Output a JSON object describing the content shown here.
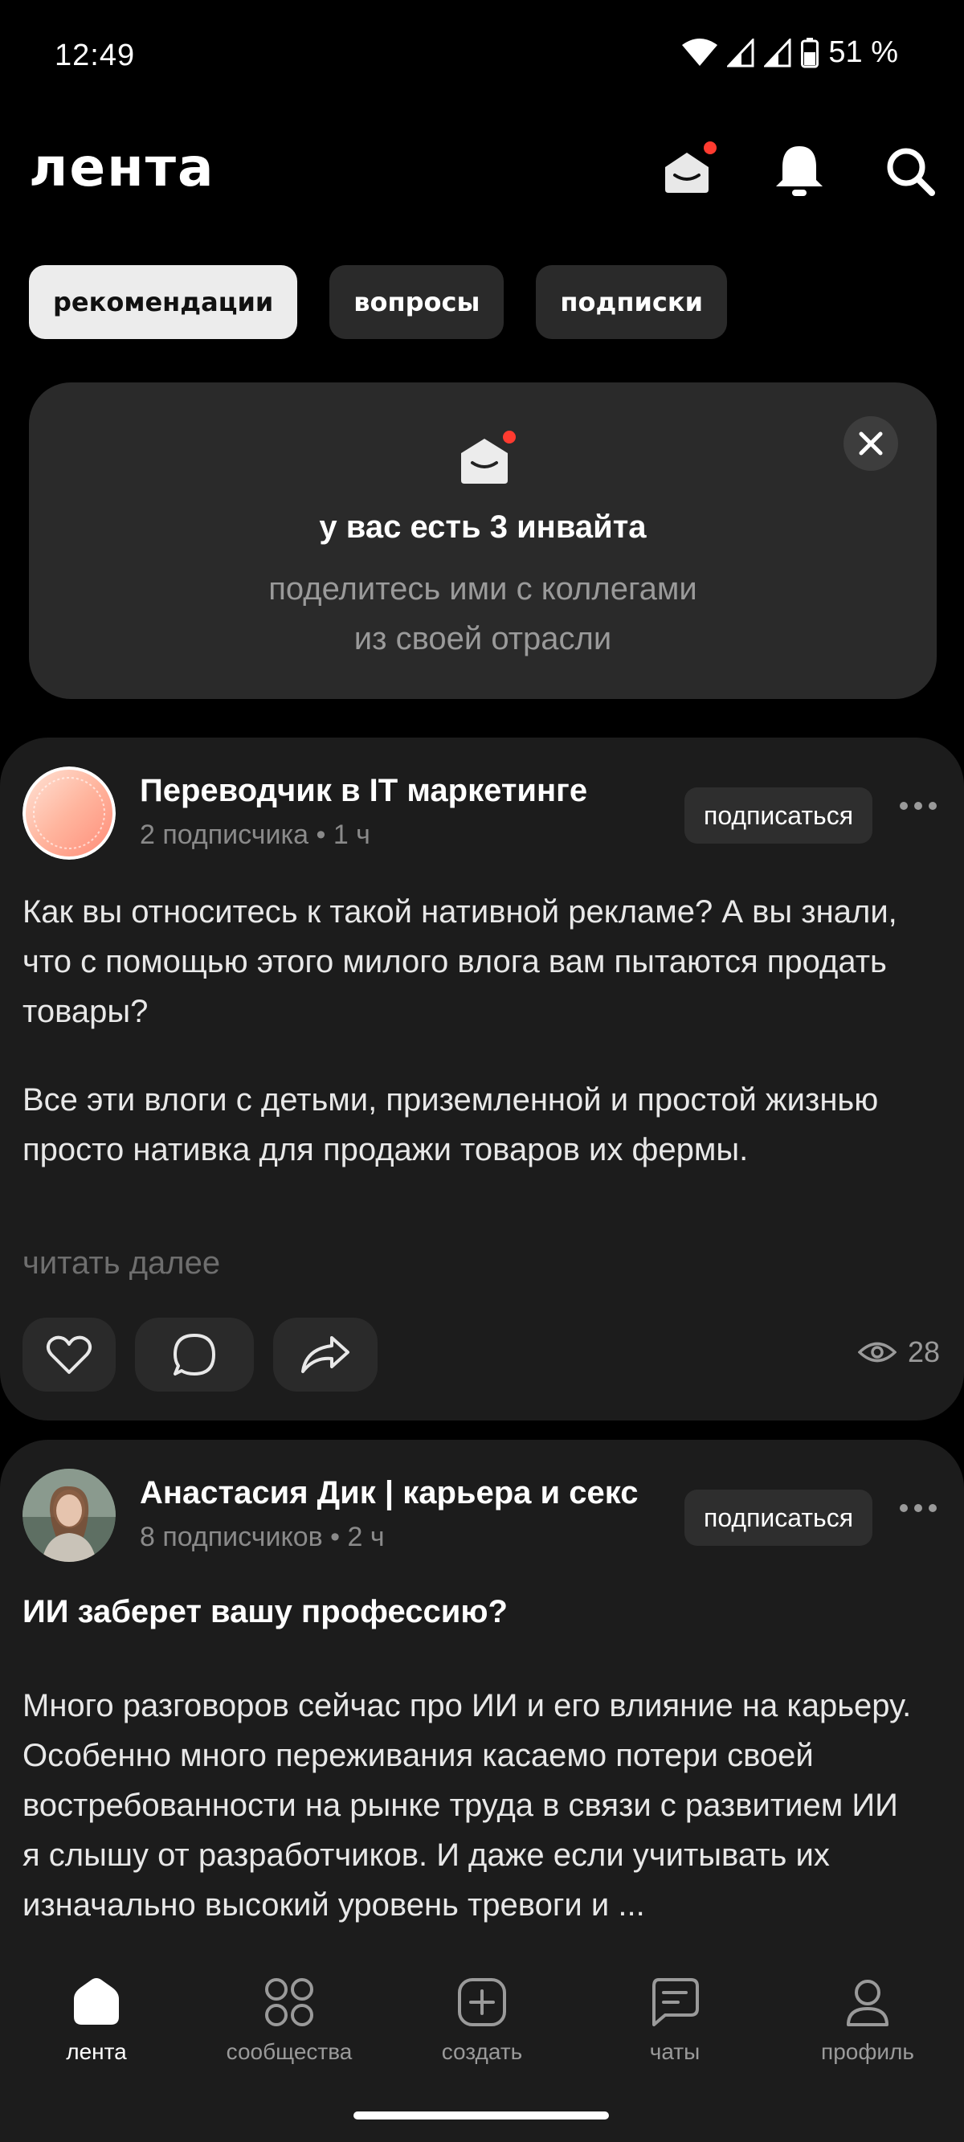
{
  "status": {
    "time": "12:49",
    "battery": "51 %"
  },
  "header": {
    "logo": "лента",
    "icons": [
      "mail-icon",
      "bell-icon",
      "search-icon"
    ]
  },
  "tabs": [
    {
      "label": "рекомендации",
      "active": true
    },
    {
      "label": "вопросы",
      "active": false
    },
    {
      "label": "подписки",
      "active": false
    }
  ],
  "invite": {
    "title": "у вас есть 3 инвайта",
    "subtitle_line1": "поделитесь ими с коллегами",
    "subtitle_line2": "из своей отрасли"
  },
  "posts": [
    {
      "author": "Переводчик в IT маркетинге",
      "meta": "2 подписчика • 1 ч",
      "subscribe_label": "подписаться",
      "paragraph1": "Как вы относитесь к такой нативной рекламе? А вы знали, что с помощью этого  милого влога вам пытаются продать товары?",
      "paragraph2": "Все эти влоги с детьми, приземленной и простой жизнью просто нативка для продажи товаров их фермы.",
      "read_more": "читать далее",
      "views": "28"
    },
    {
      "author": "Анастасия Дик | карьера и секс",
      "meta": "8 подписчиков • 2 ч",
      "subscribe_label": "подписаться",
      "heading": "ИИ заберет вашу профессию?",
      "paragraph1": "Много разговоров сейчас про ИИ и его влияние на карьеру. Особенно много переживания касаемо потери своей востребованности на рынке труда в связи с развитием ИИ я слышу от разработчиков. И даже если учитывать их изначально высокий уровень тревоги и ..."
    }
  ],
  "bottom_nav": [
    {
      "label": "лента",
      "icon": "home-icon",
      "active": true
    },
    {
      "label": "сообщества",
      "icon": "grid-icon",
      "active": false
    },
    {
      "label": "создать",
      "icon": "plus-square-icon",
      "active": false
    },
    {
      "label": "чаты",
      "icon": "chat-icon",
      "active": false
    },
    {
      "label": "профиль",
      "icon": "user-icon",
      "active": false
    }
  ],
  "colors": {
    "background": "#000000",
    "card": "#1c1c1c",
    "accent_dot": "#ff3b30"
  }
}
